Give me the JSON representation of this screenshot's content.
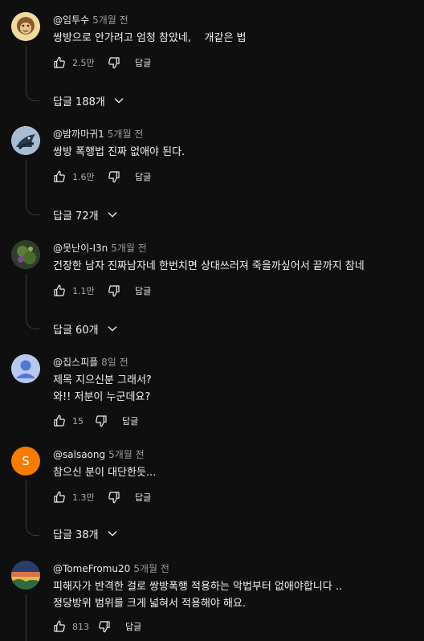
{
  "reply_label": "답글",
  "comments": [
    {
      "handle": "@임투수",
      "time": "5개월 전",
      "lines": [
        "쌍방으로 안가려고 엄청 참았네,    개같은 법"
      ],
      "likes": "2.5만",
      "replies": "답글 188개",
      "avatar_color": "#e8d090"
    },
    {
      "handle": "@밤까마귀1",
      "time": "5개월 전",
      "lines": [
        "쌍방 폭행법 진짜 없애야 된다."
      ],
      "likes": "1.6만",
      "replies": "답글 72개",
      "avatar_color": "#6b8aa8"
    },
    {
      "handle": "@못난이-I3n",
      "time": "5개월 전",
      "lines": [
        "건장한 남자 진짜남자네 한번치면 상대쓰러져 죽을까싶어서 끝까지 참네"
      ],
      "likes": "1.1만",
      "replies": "답글 60개",
      "avatar_color": "#3f5a3a"
    },
    {
      "handle": "@집스피플",
      "time": "8일 전",
      "lines": [
        "제목 지으신분 그래서?",
        "와!! 저분이 누군데요?"
      ],
      "likes": "15",
      "replies": "",
      "avatar_color": "#b8c8ee"
    },
    {
      "handle": "@salsaong",
      "time": "5개월 전",
      "lines": [
        "참으신 분이 대단한듯..."
      ],
      "likes": "1.3만",
      "replies": "답글 38개",
      "avatar_color": "#f57c00",
      "avatar_letter": "S"
    },
    {
      "handle": "@TomeFromu20",
      "time": "5개월 전",
      "lines": [
        "피해자가 반격한 걸로 쌍방폭행 적용하는 악법부터 없애야합니다 ..",
        "정당방위 범위를 크게 넓혀서 적용해야 해요."
      ],
      "likes": "813",
      "replies": "",
      "avatar_color": "#2a3e6e"
    }
  ]
}
